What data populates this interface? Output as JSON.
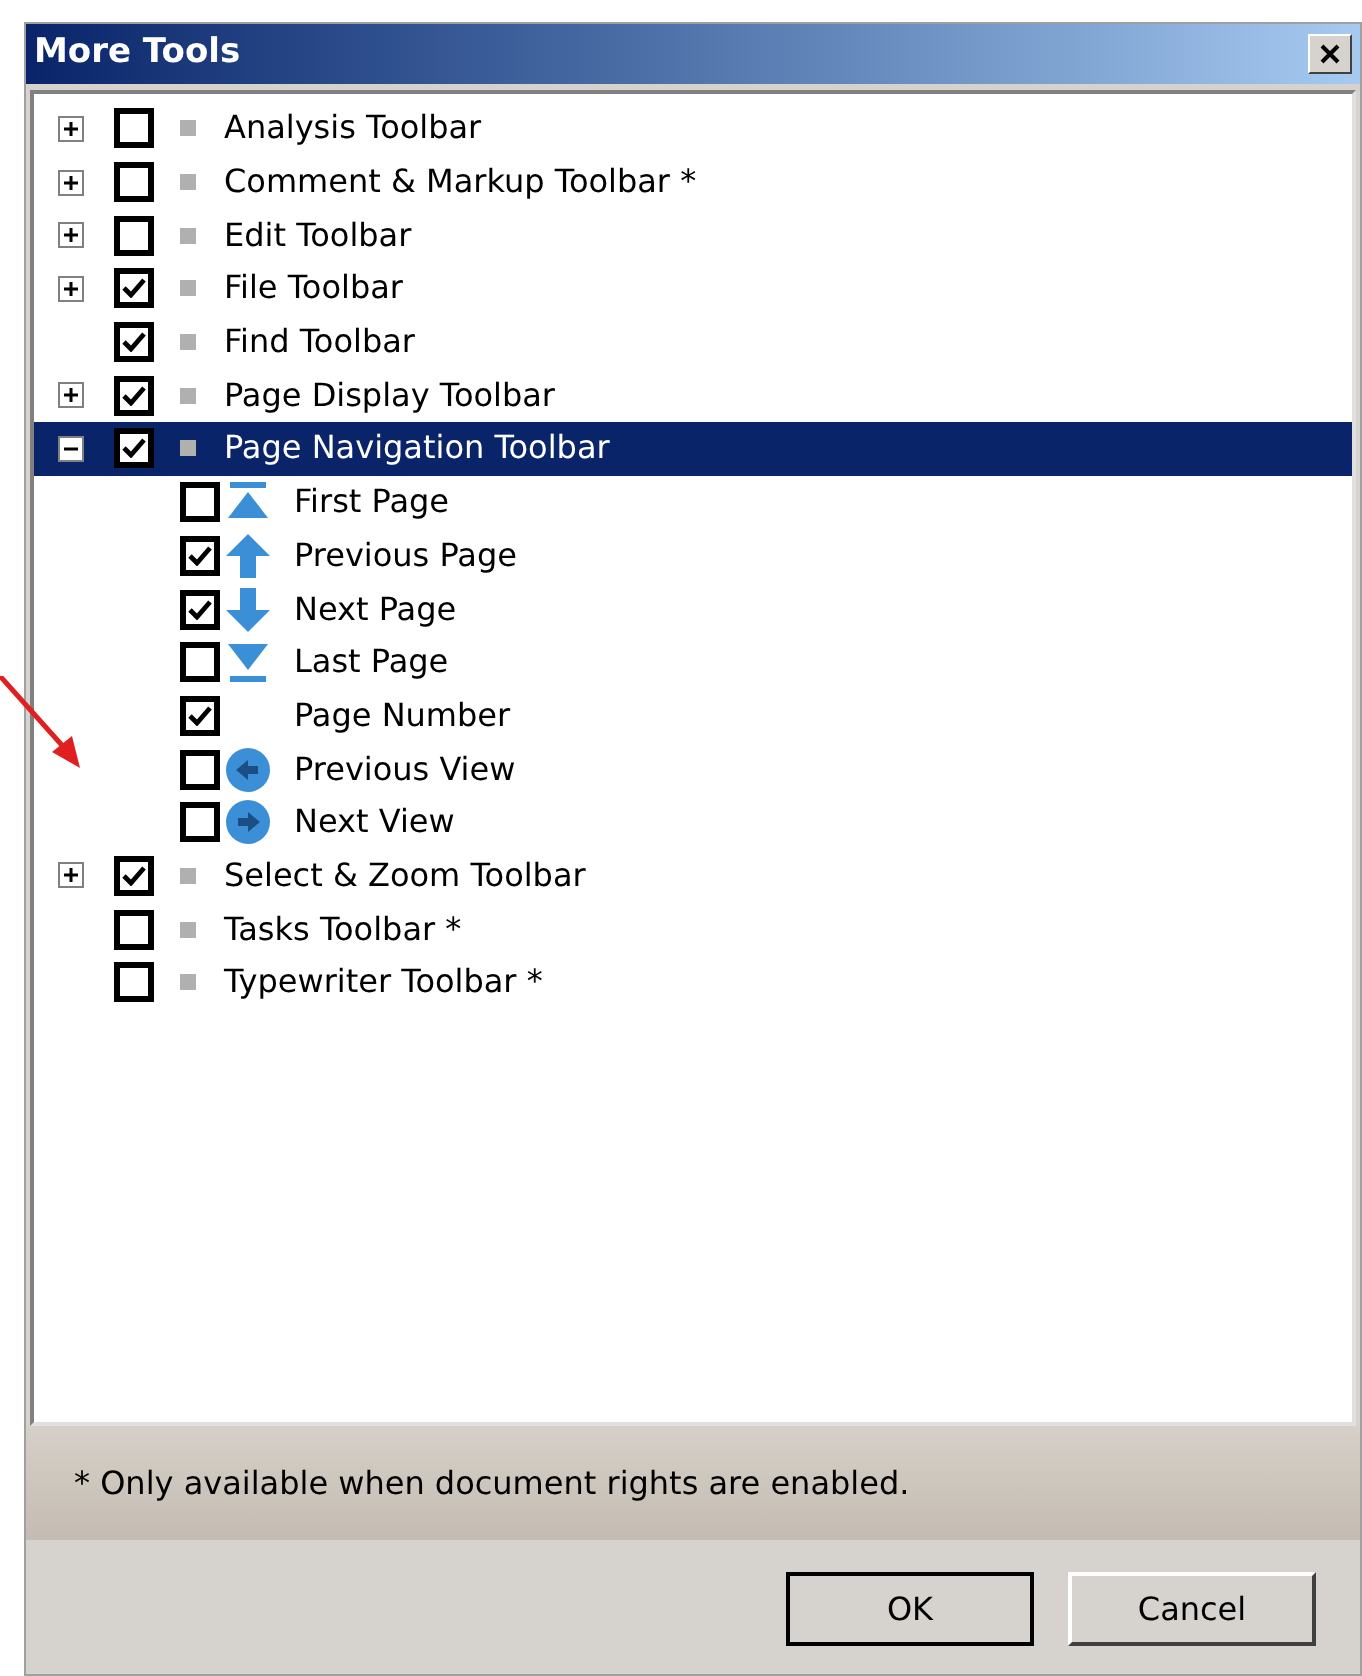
{
  "window": {
    "title": "More Tools"
  },
  "tree": [
    {
      "label": "Analysis Toolbar",
      "checked": false,
      "expanded": false,
      "selected": false
    },
    {
      "label": "Comment & Markup Toolbar *",
      "checked": false,
      "expanded": false,
      "selected": false
    },
    {
      "label": "Edit Toolbar",
      "checked": false,
      "expanded": false,
      "selected": false
    },
    {
      "label": "File Toolbar",
      "checked": true,
      "expanded": false,
      "selected": false
    },
    {
      "label": "Find Toolbar",
      "checked": true,
      "selected": false
    },
    {
      "label": "Page Display Toolbar",
      "checked": true,
      "expanded": false,
      "selected": false
    },
    {
      "label": "Page Navigation Toolbar",
      "checked": true,
      "expanded": true,
      "selected": true,
      "children": [
        {
          "label": "First Page",
          "checked": false,
          "kind": "first"
        },
        {
          "label": "Previous Page",
          "checked": true,
          "kind": "up"
        },
        {
          "label": "Next Page",
          "checked": true,
          "kind": "down"
        },
        {
          "label": "Last Page",
          "checked": false,
          "kind": "last"
        },
        {
          "label": "Page Number",
          "checked": true,
          "kind": "plain"
        },
        {
          "label": "Previous View",
          "checked": false,
          "kind": "back"
        },
        {
          "label": "Next View",
          "checked": false,
          "kind": "forward"
        }
      ]
    },
    {
      "label": "Select & Zoom Toolbar",
      "checked": true,
      "expanded": false,
      "selected": false
    },
    {
      "label": "Tasks Toolbar *",
      "checked": false,
      "selected": false
    },
    {
      "label": "Typewriter Toolbar *",
      "checked": false,
      "selected": false
    }
  ],
  "note": "* Only available when document rights are enabled.",
  "buttons": [
    "OK",
    "Cancel"
  ]
}
